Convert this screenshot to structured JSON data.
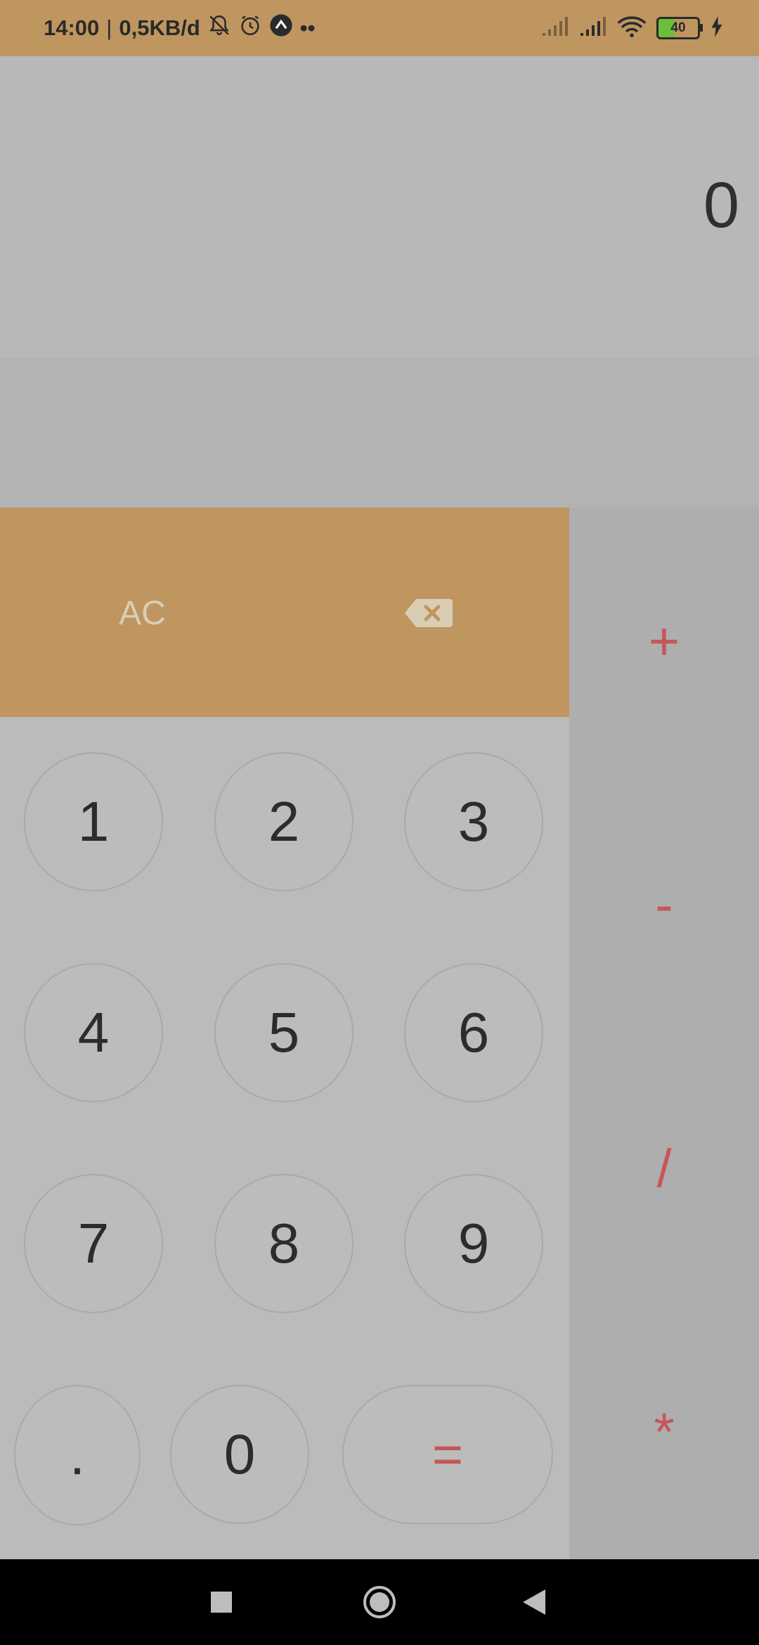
{
  "status_bar": {
    "time": "14:00",
    "separator": "|",
    "network_speed": "0,5KB/d",
    "icons_left": [
      "bell-muted-icon",
      "alarm-clock-icon",
      "app-notification-icon",
      "more-dots-icon"
    ],
    "icons_right": [
      "signal-empty-icon",
      "signal-icon",
      "wifi-icon",
      "battery-icon",
      "charging-icon"
    ],
    "battery_level": "40",
    "dots": "••"
  },
  "display": {
    "value": "0"
  },
  "controls": {
    "clear_label": "AC",
    "backspace_icon": "backspace-icon"
  },
  "keypad": {
    "digits": [
      "1",
      "2",
      "3",
      "4",
      "5",
      "6",
      "7",
      "8",
      "9"
    ],
    "dot": ".",
    "zero": "0",
    "equals": "="
  },
  "operators": {
    "add": "+",
    "subtract": "-",
    "divide": "/",
    "multiply": "*"
  },
  "nav_bar": {
    "recents_icon": "square-recents-icon",
    "home_icon": "circle-home-icon",
    "back_icon": "triangle-back-icon"
  },
  "colors": {
    "accent": "#bf9660",
    "operator_text": "#c4575a",
    "battery_fill": "#6bbf3a"
  }
}
